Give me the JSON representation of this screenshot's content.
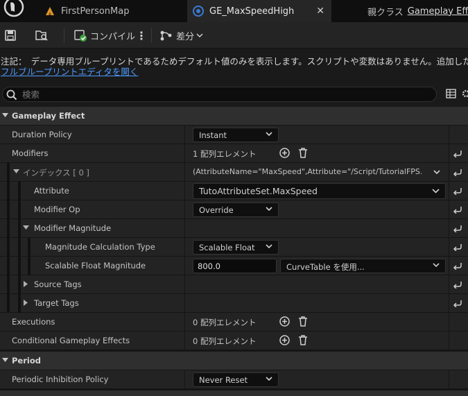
{
  "tabs": [
    {
      "label": "FirstPersonMap",
      "icon": "level-icon"
    },
    {
      "label": "GE_MaxSpeedHigh",
      "icon": "blueprint-icon",
      "active": true
    }
  ],
  "parent_class": {
    "label": "親クラス",
    "value": "Gameplay Effect"
  },
  "toolbar": {
    "compile_label": "コンパイル",
    "diff_label": "差分"
  },
  "notice": {
    "text": "注記：　データ専用ブループリントであるためデフォルト値のみを表示します。スクリプトや変数はありません。追加したい場",
    "link": "フルブループリントエディタを開く"
  },
  "search": {
    "placeholder": "検索"
  },
  "details": {
    "gameplay_effect_category": "Gameplay Effect",
    "duration_policy": {
      "label": "Duration Policy",
      "value": "Instant"
    },
    "modifiers": {
      "label": "Modifiers",
      "value": "1 配列エレメント"
    },
    "index": {
      "label": "インデックス [ 0 ]",
      "value": "(AttributeName=\"MaxSpeed\",Attribute=\"/Script/TutorialFPS.Tuto"
    },
    "attribute": {
      "label": "Attribute",
      "value": "TutoAttributeSet.MaxSpeed"
    },
    "modifier_op": {
      "label": "Modifier Op",
      "value": "Override"
    },
    "modifier_magnitude": {
      "label": "Modifier Magnitude"
    },
    "magnitude_calc_type": {
      "label": "Magnitude Calculation Type",
      "value": "Scalable Float"
    },
    "scalable_float_magnitude": {
      "label": "Scalable Float Magnitude",
      "value": "800.0",
      "curve": "CurveTable を使用..."
    },
    "source_tags": {
      "label": "Source Tags"
    },
    "target_tags": {
      "label": "Target Tags"
    },
    "executions": {
      "label": "Executions",
      "value": "0 配列エレメント"
    },
    "conditional_effects": {
      "label": "Conditional Gameplay Effects",
      "value": "0 配列エレメント"
    },
    "period_category": "Period",
    "periodic_inhibition": {
      "label": "Periodic Inhibition Policy",
      "value": "Never Reset"
    }
  },
  "colors": {
    "link": "#4d9bff",
    "accent_blue": "#3a7bd5",
    "bg": "#151515"
  }
}
